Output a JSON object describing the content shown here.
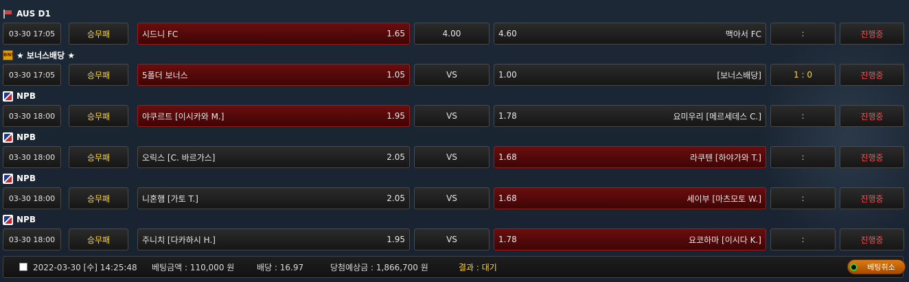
{
  "leagues": [
    {
      "name": "AUS D1",
      "icon": "flag-icon"
    },
    {
      "name": "★ 보너스배당 ★",
      "icon": "bonus-icon",
      "icon_text": "BNS"
    },
    {
      "name": "NPB",
      "icon": "npb-icon"
    },
    {
      "name": "NPB",
      "icon": "npb-icon"
    },
    {
      "name": "NPB",
      "icon": "npb-icon"
    },
    {
      "name": "NPB",
      "icon": "npb-icon"
    }
  ],
  "games": [
    {
      "date": "03-30 17:05",
      "type": "승무패",
      "home": "시드니 FC",
      "home_odds": "1.65",
      "draw": "4.00",
      "away_odds": "4.60",
      "away": "맥아서 FC",
      "score": ":",
      "status": "진행중",
      "pick": "home"
    },
    {
      "date": "03-30 17:05",
      "type": "승무패",
      "home": "5폴더 보너스",
      "home_odds": "1.05",
      "draw": "VS",
      "away_odds": "1.00",
      "away": "[보너스배당]",
      "score": "1 : 0",
      "status": "진행중",
      "pick": "home"
    },
    {
      "date": "03-30 18:00",
      "type": "승무패",
      "home": "야쿠르트 [이시카와 M.]",
      "home_odds": "1.95",
      "draw": "VS",
      "away_odds": "1.78",
      "away": "요미우리 [메르세데스 C.]",
      "score": ":",
      "status": "진행중",
      "pick": "home"
    },
    {
      "date": "03-30 18:00",
      "type": "승무패",
      "home": "오릭스 [C. 바르가스]",
      "home_odds": "2.05",
      "draw": "VS",
      "away_odds": "1.68",
      "away": "라쿠텐 [하야가와 T.]",
      "score": ":",
      "status": "진행중",
      "pick": "away"
    },
    {
      "date": "03-30 18:00",
      "type": "승무패",
      "home": "니혼햄 [가토 T.]",
      "home_odds": "2.05",
      "draw": "VS",
      "away_odds": "1.68",
      "away": "세이부 [마츠모토 W.]",
      "score": ":",
      "status": "진행중",
      "pick": "away"
    },
    {
      "date": "03-30 18:00",
      "type": "승무패",
      "home": "주니치 [다카하시 H.]",
      "home_odds": "1.95",
      "draw": "VS",
      "away_odds": "1.78",
      "away": "요코하마 [이시다 K.]",
      "score": ":",
      "status": "진행중",
      "pick": "away"
    }
  ],
  "footer": {
    "datetime": "2022-03-30 [수] 14:25:48",
    "bet_amount": "베팅금액 : 110,000 원",
    "odds": "배당 : 16.97",
    "expected_win": "당첨예상금 : 1,866,700 원",
    "result": "결과 : 대기",
    "cancel_label": "베팅취소"
  },
  "colors": {
    "selected": "#6a0d0d",
    "status": "#ff4a4a",
    "accent": "#ffd84a",
    "cancel": "#e07a10"
  }
}
